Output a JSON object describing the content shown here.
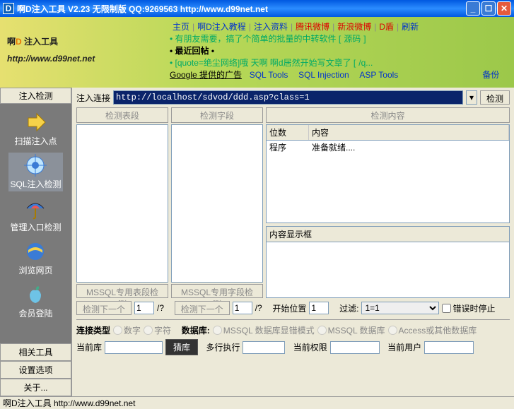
{
  "window": {
    "title": "啊D注入工具  V2.23 无限制版  QQ:9269563 http://www.d99net.net",
    "icon_letter": "D"
  },
  "banner": {
    "logo_pre": "啊",
    "logo_d": "D",
    "logo_post": " 注入工具",
    "url": "http://www.d99net.net",
    "nav": {
      "home": "主页",
      "tutorial": "啊D注入教程",
      "material": "注入资料",
      "tencent": "腾讯微博",
      "sina": "新浪微博",
      "dshield": "D盾",
      "refresh": "刷新"
    },
    "line2_pre": "• 有朋友需要，搞了个简单的批量的中转软件 [",
    "line2_link": "源码",
    "line2_post": "]",
    "line3_label": "• 最近回帖 •",
    "line4_pre": "• [quote=绝尘网络]哦  天啊  啊d居然开始写文章了 [",
    "line4_link": "/q...",
    "ad_label": "Google 提供的广告",
    "ad1": "SQL Tools",
    "ad2": "SQL Injection",
    "ad3": "ASP Tools",
    "backup": "备份"
  },
  "sidebar": {
    "header": "注入检测",
    "items": [
      {
        "label": "扫描注入点",
        "icon": "arrow"
      },
      {
        "label": "SQL注入检测",
        "icon": "target"
      },
      {
        "label": "管理入口检测",
        "icon": "umbrella"
      },
      {
        "label": "浏览网页",
        "icon": "ie"
      },
      {
        "label": "会员登陆",
        "icon": "apple"
      }
    ],
    "footer": [
      "相关工具",
      "设置选项",
      "关于..."
    ]
  },
  "content": {
    "url_label": "注入连接",
    "url_value": "http://localhost/sdvod/ddd.asp?class=1",
    "detect_btn": "检测",
    "panel1_btn": "检测表段",
    "panel2_btn": "检测字段",
    "panel3_btn": "检测内容",
    "table_cols": {
      "c1": "位数",
      "c2": "内容"
    },
    "table_row": {
      "c1": "程序",
      "c2": "准备就绪...."
    },
    "display_box_label": "内容显示框",
    "mssql_table_btn": "MSSQL专用表段检测",
    "mssql_field_btn": "MSSQL专用字段检测",
    "row1": {
      "detect_next": "检测下一个",
      "start_pos": "开始位置",
      "start_val": "1",
      "filter": "过滤:",
      "filter_val": "1=1",
      "stop_on_err": "错误时停止",
      "val1": "1",
      "val2": "1",
      "q": "/?"
    },
    "row2": {
      "conn_type": "连接类型",
      "num": "数字",
      "char": "字符",
      "db_label": "数据库:",
      "mssql_err": "MSSQL 数据库显错模式",
      "mssql_db": "MSSQL 数据库",
      "access_db": "Access或其他数据库"
    },
    "row3": {
      "cur_db": "当前库",
      "guess_db": "猜库",
      "multi_exec": "多行执行",
      "cur_priv": "当前权限",
      "cur_user": "当前用户"
    }
  },
  "statusbar": "啊D注入工具 http://www.d99net.net"
}
